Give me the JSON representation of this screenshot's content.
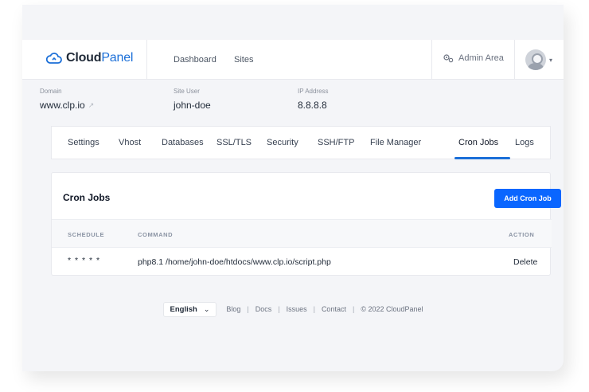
{
  "header": {
    "logo_part1": "Cloud",
    "logo_part2": "Panel",
    "nav": [
      {
        "label": "Dashboard"
      },
      {
        "label": "Sites"
      }
    ],
    "admin_area": "Admin Area"
  },
  "site_info": [
    {
      "label": "Domain",
      "value": "www.clp.io"
    },
    {
      "label": "Site User",
      "value": "john-doe"
    },
    {
      "label": "IP Address",
      "value": "8.8.8.8"
    }
  ],
  "tabs": [
    {
      "label": "Settings"
    },
    {
      "label": "Vhost"
    },
    {
      "label": "Databases"
    },
    {
      "label": "SSL/TLS"
    },
    {
      "label": "Security"
    },
    {
      "label": "SSH/FTP"
    },
    {
      "label": "File Manager"
    },
    {
      "label": "Cron Jobs"
    },
    {
      "label": "Logs"
    }
  ],
  "active_tab": "Cron Jobs",
  "cron_card": {
    "title": "Cron Jobs",
    "add_button": "Add Cron Job",
    "columns": [
      "SCHEDULE",
      "COMMAND",
      "ACTION"
    ],
    "rows": [
      {
        "schedule": "* * * * *",
        "command": "php8.1 /home/john-doe/htdocs/www.clp.io/script.php",
        "action": "Delete"
      }
    ]
  },
  "footer": {
    "language": "English",
    "links": [
      {
        "label": "Blog"
      },
      {
        "label": "Docs"
      },
      {
        "label": "Issues"
      },
      {
        "label": "Contact"
      }
    ],
    "copyright": "© 2022  CloudPanel"
  },
  "colors": {
    "accent": "#1b6fd8",
    "button": "#0a66ff",
    "background": "#f4f5f8"
  }
}
